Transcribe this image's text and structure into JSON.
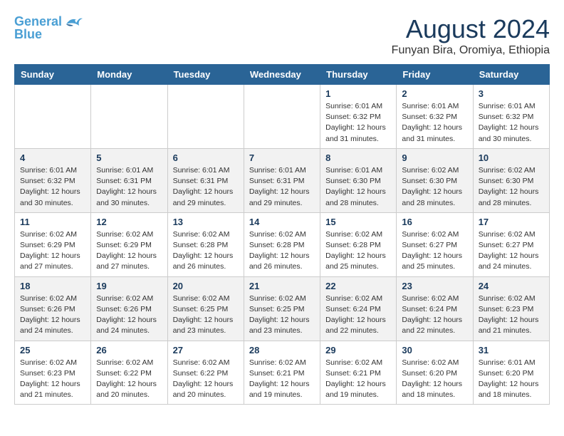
{
  "header": {
    "logo_line1": "General",
    "logo_line2": "Blue",
    "month_year": "August 2024",
    "location": "Funyan Bira, Oromiya, Ethiopia"
  },
  "weekdays": [
    "Sunday",
    "Monday",
    "Tuesday",
    "Wednesday",
    "Thursday",
    "Friday",
    "Saturday"
  ],
  "weeks": [
    [
      {
        "day": "",
        "info": ""
      },
      {
        "day": "",
        "info": ""
      },
      {
        "day": "",
        "info": ""
      },
      {
        "day": "",
        "info": ""
      },
      {
        "day": "1",
        "info": "Sunrise: 6:01 AM\nSunset: 6:32 PM\nDaylight: 12 hours\nand 31 minutes."
      },
      {
        "day": "2",
        "info": "Sunrise: 6:01 AM\nSunset: 6:32 PM\nDaylight: 12 hours\nand 31 minutes."
      },
      {
        "day": "3",
        "info": "Sunrise: 6:01 AM\nSunset: 6:32 PM\nDaylight: 12 hours\nand 30 minutes."
      }
    ],
    [
      {
        "day": "4",
        "info": "Sunrise: 6:01 AM\nSunset: 6:32 PM\nDaylight: 12 hours\nand 30 minutes."
      },
      {
        "day": "5",
        "info": "Sunrise: 6:01 AM\nSunset: 6:31 PM\nDaylight: 12 hours\nand 30 minutes."
      },
      {
        "day": "6",
        "info": "Sunrise: 6:01 AM\nSunset: 6:31 PM\nDaylight: 12 hours\nand 29 minutes."
      },
      {
        "day": "7",
        "info": "Sunrise: 6:01 AM\nSunset: 6:31 PM\nDaylight: 12 hours\nand 29 minutes."
      },
      {
        "day": "8",
        "info": "Sunrise: 6:01 AM\nSunset: 6:30 PM\nDaylight: 12 hours\nand 28 minutes."
      },
      {
        "day": "9",
        "info": "Sunrise: 6:02 AM\nSunset: 6:30 PM\nDaylight: 12 hours\nand 28 minutes."
      },
      {
        "day": "10",
        "info": "Sunrise: 6:02 AM\nSunset: 6:30 PM\nDaylight: 12 hours\nand 28 minutes."
      }
    ],
    [
      {
        "day": "11",
        "info": "Sunrise: 6:02 AM\nSunset: 6:29 PM\nDaylight: 12 hours\nand 27 minutes."
      },
      {
        "day": "12",
        "info": "Sunrise: 6:02 AM\nSunset: 6:29 PM\nDaylight: 12 hours\nand 27 minutes."
      },
      {
        "day": "13",
        "info": "Sunrise: 6:02 AM\nSunset: 6:28 PM\nDaylight: 12 hours\nand 26 minutes."
      },
      {
        "day": "14",
        "info": "Sunrise: 6:02 AM\nSunset: 6:28 PM\nDaylight: 12 hours\nand 26 minutes."
      },
      {
        "day": "15",
        "info": "Sunrise: 6:02 AM\nSunset: 6:28 PM\nDaylight: 12 hours\nand 25 minutes."
      },
      {
        "day": "16",
        "info": "Sunrise: 6:02 AM\nSunset: 6:27 PM\nDaylight: 12 hours\nand 25 minutes."
      },
      {
        "day": "17",
        "info": "Sunrise: 6:02 AM\nSunset: 6:27 PM\nDaylight: 12 hours\nand 24 minutes."
      }
    ],
    [
      {
        "day": "18",
        "info": "Sunrise: 6:02 AM\nSunset: 6:26 PM\nDaylight: 12 hours\nand 24 minutes."
      },
      {
        "day": "19",
        "info": "Sunrise: 6:02 AM\nSunset: 6:26 PM\nDaylight: 12 hours\nand 24 minutes."
      },
      {
        "day": "20",
        "info": "Sunrise: 6:02 AM\nSunset: 6:25 PM\nDaylight: 12 hours\nand 23 minutes."
      },
      {
        "day": "21",
        "info": "Sunrise: 6:02 AM\nSunset: 6:25 PM\nDaylight: 12 hours\nand 23 minutes."
      },
      {
        "day": "22",
        "info": "Sunrise: 6:02 AM\nSunset: 6:24 PM\nDaylight: 12 hours\nand 22 minutes."
      },
      {
        "day": "23",
        "info": "Sunrise: 6:02 AM\nSunset: 6:24 PM\nDaylight: 12 hours\nand 22 minutes."
      },
      {
        "day": "24",
        "info": "Sunrise: 6:02 AM\nSunset: 6:23 PM\nDaylight: 12 hours\nand 21 minutes."
      }
    ],
    [
      {
        "day": "25",
        "info": "Sunrise: 6:02 AM\nSunset: 6:23 PM\nDaylight: 12 hours\nand 21 minutes."
      },
      {
        "day": "26",
        "info": "Sunrise: 6:02 AM\nSunset: 6:22 PM\nDaylight: 12 hours\nand 20 minutes."
      },
      {
        "day": "27",
        "info": "Sunrise: 6:02 AM\nSunset: 6:22 PM\nDaylight: 12 hours\nand 20 minutes."
      },
      {
        "day": "28",
        "info": "Sunrise: 6:02 AM\nSunset: 6:21 PM\nDaylight: 12 hours\nand 19 minutes."
      },
      {
        "day": "29",
        "info": "Sunrise: 6:02 AM\nSunset: 6:21 PM\nDaylight: 12 hours\nand 19 minutes."
      },
      {
        "day": "30",
        "info": "Sunrise: 6:02 AM\nSunset: 6:20 PM\nDaylight: 12 hours\nand 18 minutes."
      },
      {
        "day": "31",
        "info": "Sunrise: 6:01 AM\nSunset: 6:20 PM\nDaylight: 12 hours\nand 18 minutes."
      }
    ]
  ]
}
